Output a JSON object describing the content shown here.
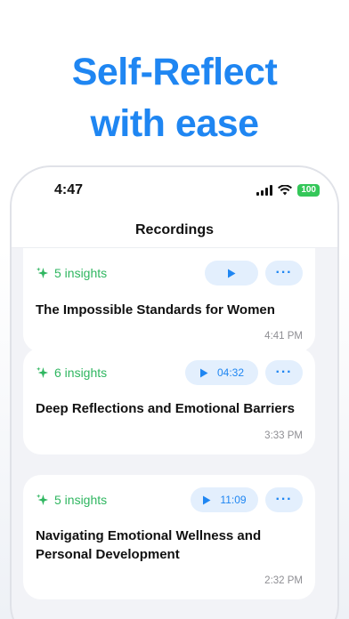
{
  "headline": {
    "line1": "Self-Reflect",
    "line2": "with ease"
  },
  "status": {
    "time": "4:47",
    "battery": "100"
  },
  "nav": {
    "title": "Recordings"
  },
  "recordings": [
    {
      "insights": "5 insights",
      "title": "The Impossible Standards for Women",
      "duration": "",
      "time": "4:41 PM"
    },
    {
      "insights": "6 insights",
      "title": "Deep Reflections and Emotional Barriers",
      "duration": "04:32",
      "time": "3:33 PM"
    },
    {
      "insights": "5 insights",
      "title_line1": "Navigating Emotional Wellness and",
      "title_line2": "Personal Development",
      "duration": "11:09",
      "time": "2:32 PM"
    }
  ],
  "colors": {
    "accent": "#1f86f2",
    "insight_green": "#2fb660",
    "pill_bg": "#e3effd"
  },
  "icons": {
    "sparkle": "sparkle-icon",
    "play": "play-icon",
    "more": "more-icon"
  }
}
